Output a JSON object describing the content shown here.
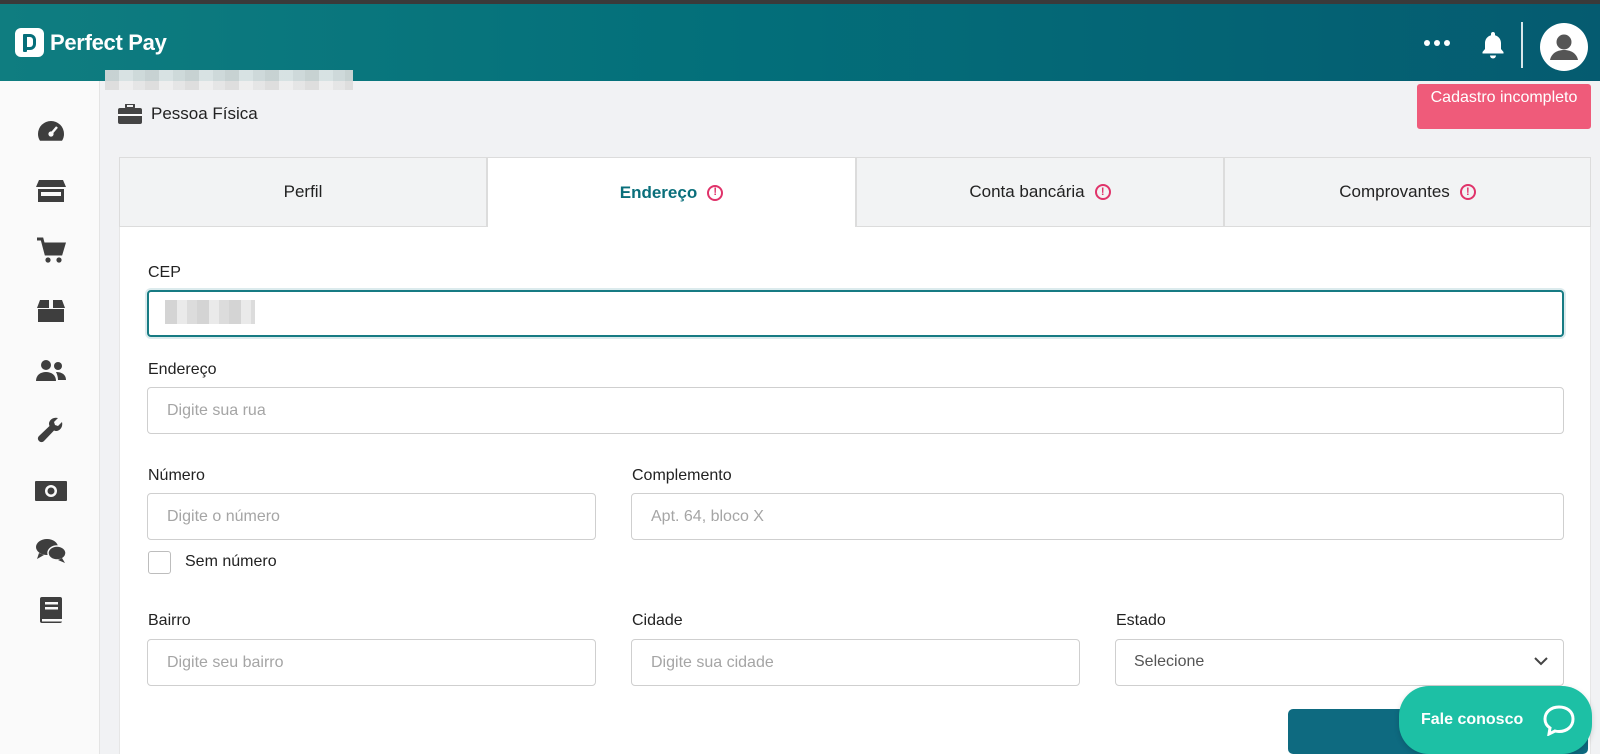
{
  "header": {
    "brand": "Perfect Pay",
    "menu_icon": "more-dots-icon",
    "bell_icon": "bell-icon",
    "avatar_icon": "user-avatar-icon"
  },
  "sidebar": {
    "items": [
      {
        "icon": "dashboard-gauge-icon"
      },
      {
        "icon": "store-icon"
      },
      {
        "icon": "cart-icon"
      },
      {
        "icon": "box-icon"
      },
      {
        "icon": "users-icon"
      },
      {
        "icon": "wrench-icon"
      },
      {
        "icon": "money-icon"
      },
      {
        "icon": "chat-icon"
      },
      {
        "icon": "book-icon"
      }
    ]
  },
  "account": {
    "type_label": "Pessoa Física",
    "status_badge": "Cadastro incompleto",
    "badge_color": "#ef5b7a"
  },
  "tabs": [
    {
      "label": "Perfil",
      "active": false,
      "warning": false
    },
    {
      "label": "Endereço",
      "active": true,
      "warning": true
    },
    {
      "label": "Conta bancária",
      "active": false,
      "warning": true
    },
    {
      "label": "Comprovantes",
      "active": false,
      "warning": true
    }
  ],
  "form": {
    "cep": {
      "label": "CEP",
      "value": ""
    },
    "endereco": {
      "label": "Endereço",
      "placeholder": "Digite sua rua"
    },
    "numero": {
      "label": "Número",
      "placeholder": "Digite o número"
    },
    "complemento": {
      "label": "Complemento",
      "placeholder": "Apt. 64, bloco X"
    },
    "sem_numero": {
      "label": "Sem número",
      "checked": false
    },
    "bairro": {
      "label": "Bairro",
      "placeholder": "Digite seu bairro"
    },
    "cidade": {
      "label": "Cidade",
      "placeholder": "Digite sua cidade"
    },
    "estado": {
      "label": "Estado",
      "selected": "Selecione"
    }
  },
  "chat_widget": {
    "label": "Fale conosco"
  },
  "colors": {
    "header": "#036f7a",
    "accent": "#0a6f7b",
    "warning": "#e0336a",
    "chat": "#1dc0a5",
    "submit": "#0e6a80"
  }
}
